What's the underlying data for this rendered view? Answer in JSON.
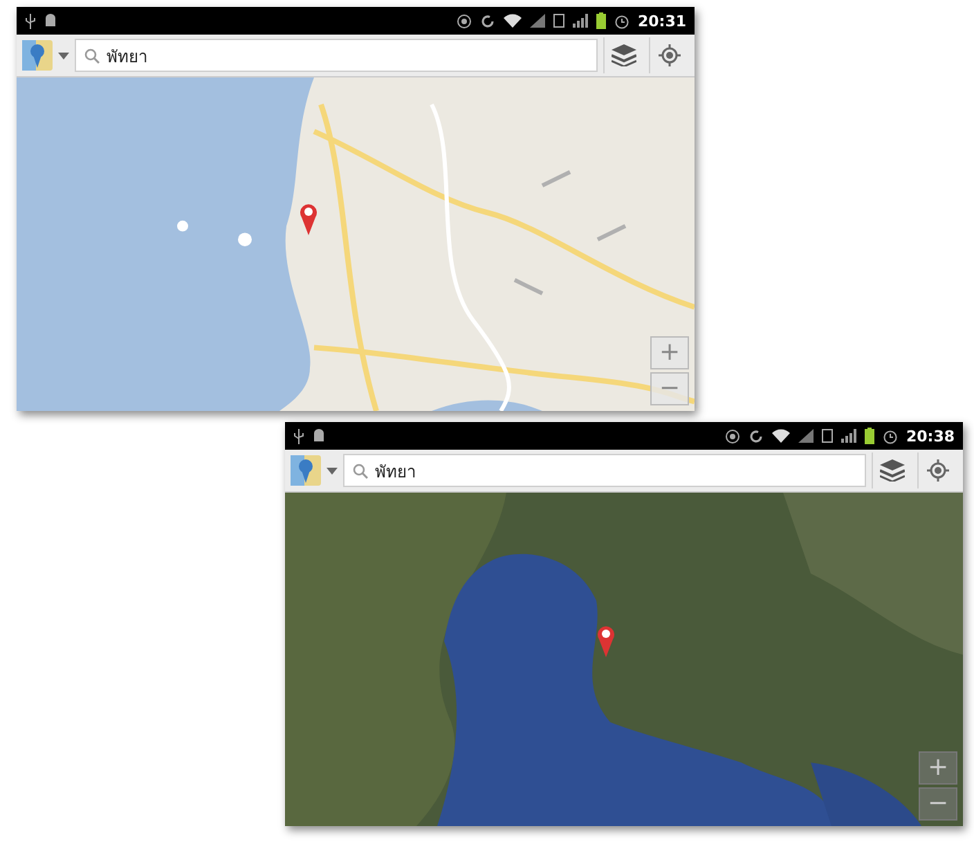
{
  "screens": [
    {
      "kind": "road",
      "status_bar": {
        "time": "20:31"
      },
      "search": {
        "value": "พัทยา"
      },
      "zoom_controls": [
        "+",
        "−"
      ]
    },
    {
      "kind": "satellite",
      "status_bar": {
        "time": "20:38"
      },
      "search": {
        "value": "พัทยา"
      },
      "zoom_controls": [
        "+",
        "−"
      ]
    }
  ]
}
